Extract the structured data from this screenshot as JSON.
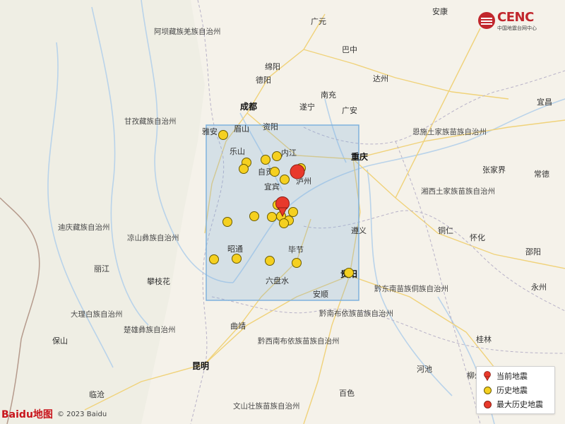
{
  "brand": {
    "name": "CENC",
    "subtitle": "中国地震台网中心"
  },
  "legend": {
    "current": "当前地震",
    "history": "历史地震",
    "max_history": "最大历史地震"
  },
  "attribution": {
    "logo": "Baidu地图",
    "copyright": "© 2023 Baidu"
  },
  "colors": {
    "history": "#f5d020",
    "max": "#e8392b",
    "current": "#e8392b",
    "rect_fill": "rgba(120,170,220,0.28)",
    "rect_stroke": "#7fb1dd"
  },
  "labels": {
    "major": [
      "成都",
      "重庆",
      "贵阳",
      "昆明"
    ],
    "cities": [
      "广元",
      "巴中",
      "德阳",
      "绵阳",
      "南充",
      "达州",
      "遂宁",
      "广安",
      "资阳",
      "眉山",
      "雅安",
      "乐山",
      "内江",
      "自贡",
      "宜宾",
      "泸州",
      "昭通",
      "毕节",
      "六盘水",
      "安顺",
      "遵义",
      "铜仁",
      "怀化",
      "邵阳",
      "永州",
      "桂林",
      "柳州",
      "河池",
      "百色",
      "曲靖",
      "攀枝花",
      "丽江",
      "保山",
      "临沧",
      "张家界",
      "常德",
      "宜昌",
      "安康"
    ],
    "regions": [
      "阿坝藏族羌族自治州",
      "甘孜藏族自治州",
      "凉山彝族自治州",
      "迪庆藏族自治州",
      "大理白族自治州",
      "楚雄彝族自治州",
      "黔西南布依族苗族自治州",
      "黔南布依族苗族自治州",
      "黔东南苗族侗族自治州",
      "湘西土家族苗族自治州",
      "恩施土家族苗族自治州",
      "文山壮族苗族自治州"
    ]
  }
}
